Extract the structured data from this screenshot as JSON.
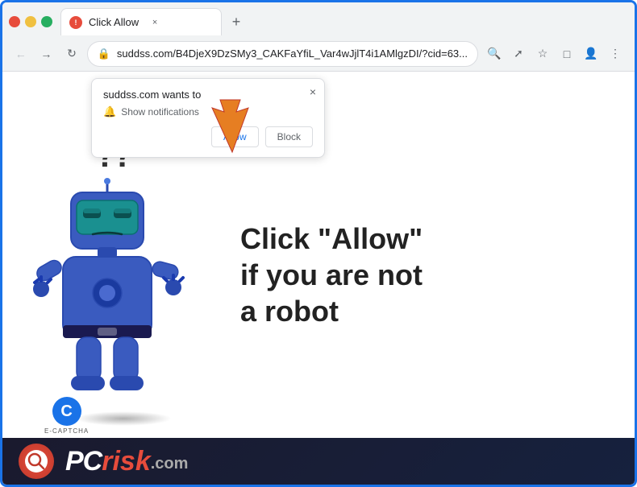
{
  "browser": {
    "tab": {
      "favicon_label": "!",
      "title": "Click Allow",
      "close_label": "×",
      "new_tab_label": "+"
    },
    "nav": {
      "back_label": "←",
      "forward_label": "→",
      "refresh_label": "↻",
      "address": "suddss.com/B4DjeX9DzSMy3_CAKFaYfiL_Var4wJjlT4i1AMlgzDI/?cid=63...",
      "lock_icon": "🔒",
      "search_icon": "🔍",
      "share_icon": "⬆",
      "star_icon": "☆",
      "extensions_icon": "□",
      "profile_icon": "👤",
      "menu_icon": "⋮"
    }
  },
  "notification_popup": {
    "header": "suddss.com wants to",
    "permission_text": "Show notifications",
    "allow_label": "Allow",
    "block_label": "Block",
    "close_label": "×"
  },
  "page": {
    "question_marks": "??",
    "main_text_line1": "Click \"Allow\"",
    "main_text_line2": "if you are not",
    "main_text_line3": "a robot"
  },
  "captcha": {
    "letter": "C",
    "label": "E-CAPTCHA"
  },
  "pcrisk": {
    "text_pc": "PC",
    "text_risk": "risk",
    "text_com": ".com"
  }
}
